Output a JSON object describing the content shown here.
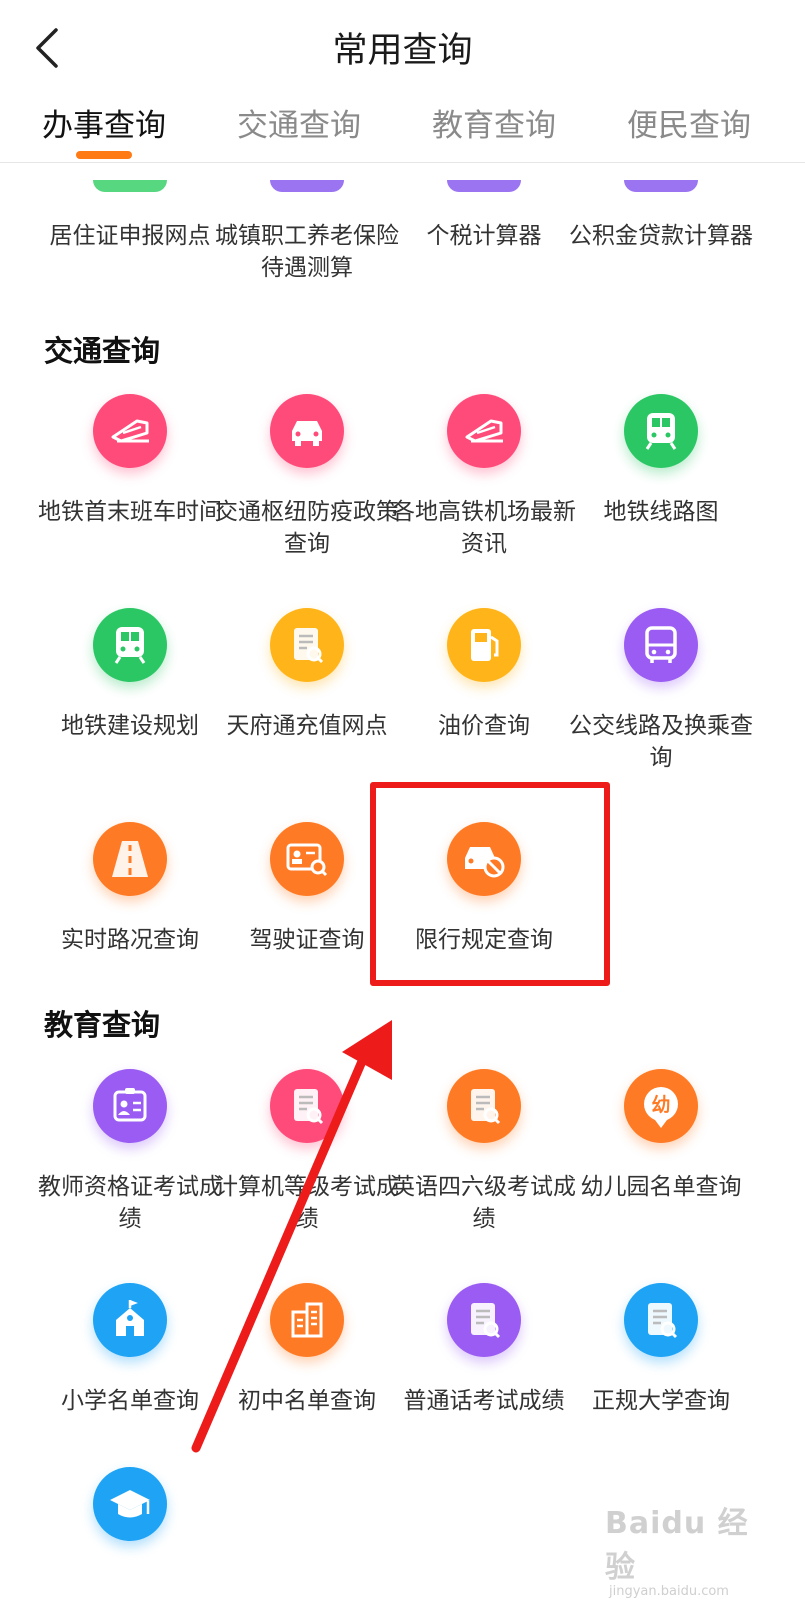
{
  "header": {
    "title": "常用查询"
  },
  "tabs": [
    {
      "label": "办事查询",
      "active": true
    },
    {
      "label": "交通查询",
      "active": false
    },
    {
      "label": "教育查询",
      "active": false
    },
    {
      "label": "便民查询",
      "active": false
    }
  ],
  "banshi_partial": {
    "items": [
      {
        "label": "居住证申报网点",
        "color": "#3ad06a"
      },
      {
        "label": "城镇职工养老保险待遇测算",
        "color": "#8a5cf0"
      },
      {
        "label": "个税计算器",
        "color": "#8a5cf0"
      },
      {
        "label": "公积金贷款计算器",
        "color": "#8a5cf0"
      }
    ]
  },
  "jiaotong": {
    "title": "交通查询",
    "items": [
      {
        "label": "地铁首末班车时间",
        "icon": "train-icon",
        "color": "#ff4b7a"
      },
      {
        "label": "交通枢纽防疫政策查询",
        "icon": "car-icon",
        "color": "#ff4b7a"
      },
      {
        "label": "各地高铁机场最新资讯",
        "icon": "train-icon",
        "color": "#ff4b7a"
      },
      {
        "label": "地铁线路图",
        "icon": "metro-icon",
        "color": "#2cc765"
      },
      {
        "label": "地铁建设规划",
        "icon": "metro-icon",
        "color": "#2cc765"
      },
      {
        "label": "天府通充值网点",
        "icon": "document-search-icon",
        "color": "#ffb51a"
      },
      {
        "label": "油价查询",
        "icon": "fuel-pump-icon",
        "color": "#ffb51a"
      },
      {
        "label": "公交线路及换乘查询",
        "icon": "bus-icon",
        "color": "#9a5cf2"
      },
      {
        "label": "实时路况查询",
        "icon": "road-icon",
        "color": "#ff7a24"
      },
      {
        "label": "驾驶证查询",
        "icon": "license-card-icon",
        "color": "#ff7a24"
      },
      {
        "label": "限行规定查询",
        "icon": "car-restricted-icon",
        "color": "#ff7a24"
      }
    ]
  },
  "jiaoyu": {
    "title": "教育查询",
    "items": [
      {
        "label": "教师资格证考试成绩",
        "icon": "id-card-icon",
        "color": "#9a5cf2"
      },
      {
        "label": "计算机等级考试成绩",
        "icon": "document-search-icon",
        "color": "#ff4b7a"
      },
      {
        "label": "英语四六级考试成绩",
        "icon": "document-search-icon",
        "color": "#ff7a24"
      },
      {
        "label": "幼儿园名单查询",
        "icon": "kindergarten-icon",
        "color": "#ff7a24"
      },
      {
        "label": "小学名单查询",
        "icon": "school-icon",
        "color": "#1ea3f5"
      },
      {
        "label": "初中名单查询",
        "icon": "building-icon",
        "color": "#ff7a24"
      },
      {
        "label": "普通话考试成绩",
        "icon": "document-search-icon",
        "color": "#9a5cf2"
      },
      {
        "label": "正规大学查询",
        "icon": "document-search-icon",
        "color": "#1ea3f5"
      },
      {
        "label": "",
        "icon": "graduation-cap-icon",
        "color": "#1ea3f5"
      }
    ]
  },
  "kindergarten_glyph": "幼",
  "watermark": {
    "brand": "Baidu 经验",
    "url": "jingyan.baidu.com"
  }
}
